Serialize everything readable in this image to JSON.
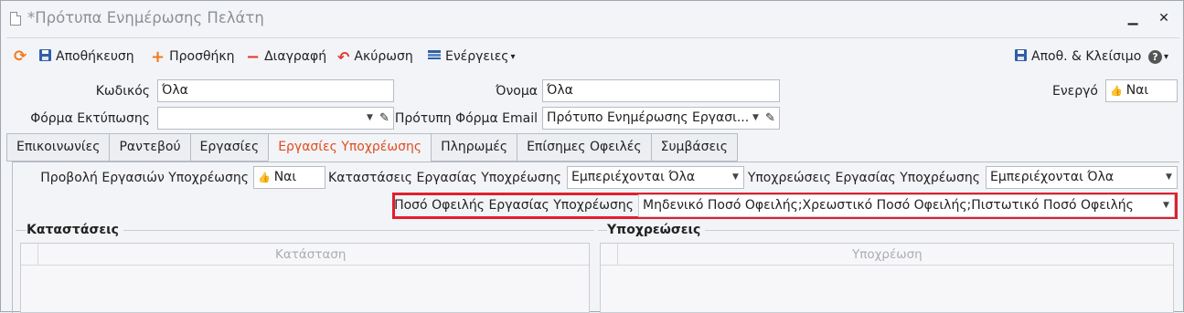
{
  "window": {
    "title": "*Πρότυπα Ενημέρωσης Πελάτη",
    "minimize": "▁",
    "close": "✕"
  },
  "toolbar": {
    "refresh_icon": "⟳",
    "save": "Αποθήκευση",
    "add": "Προσθήκη",
    "delete": "Διαγραφή",
    "cancel": "Ακύρωση",
    "actions": "Ενέργειες",
    "actions_caret": "▾",
    "save_close": "Αποθ. & Κλείσιμο",
    "help_icon": "?",
    "help_caret": "▾"
  },
  "fields": {
    "code_label": "Κωδικός",
    "code_value": "Όλα",
    "name_label": "Όνομα",
    "name_value": "Όλα",
    "active_label": "Ενεργό",
    "active_value": "Ναι",
    "print_form_label": "Φόρμα Εκτύπωσης",
    "print_form_value": "",
    "email_form_label": "Πρότυπη Φόρμα Email",
    "email_form_value": "Πρότυπο Ενημέρωσης Εργασι..."
  },
  "tabs": [
    {
      "label": "Επικοινωνίες"
    },
    {
      "label": "Ραντεβού"
    },
    {
      "label": "Εργασίες"
    },
    {
      "label": "Εργασίες Υποχρέωσης",
      "active": true
    },
    {
      "label": "Πληρωμές"
    },
    {
      "label": "Επίσημες Οφειλές"
    },
    {
      "label": "Συμβάσεις"
    }
  ],
  "obligation_tab": {
    "show_label": "Προβολή Εργασιών Υποχρέωσης",
    "show_value": "Ναι",
    "states_label": "Καταστάσεις Εργασίας Υποχρέωσης",
    "states_value": "Εμπεριέχονται Όλα",
    "obligations_label": "Υποχρεώσεις Εργασίας Υποχρέωσης",
    "obligations_value": "Εμπεριέχονται Όλα",
    "amount_label": "Ποσό Οφειλής Εργασίας Υποχρέωσης",
    "amount_value": "Μηδενικό Ποσό Οφειλής;Χρεωστικό Ποσό Οφειλής;Πιστωτικό Ποσό Οφειλής"
  },
  "groups": {
    "states_title": "Καταστάσεις",
    "states_column": "Κατάσταση",
    "obligations_title": "Υποχρεώσεις",
    "obligations_column": "Υποχρέωση"
  },
  "colors": {
    "highlight": "#e0202d",
    "active_tab": "#e04d1f",
    "accent_orange": "#f07a1a",
    "accent_red": "#e23b2a",
    "accent_blue": "#2f5fa8"
  }
}
